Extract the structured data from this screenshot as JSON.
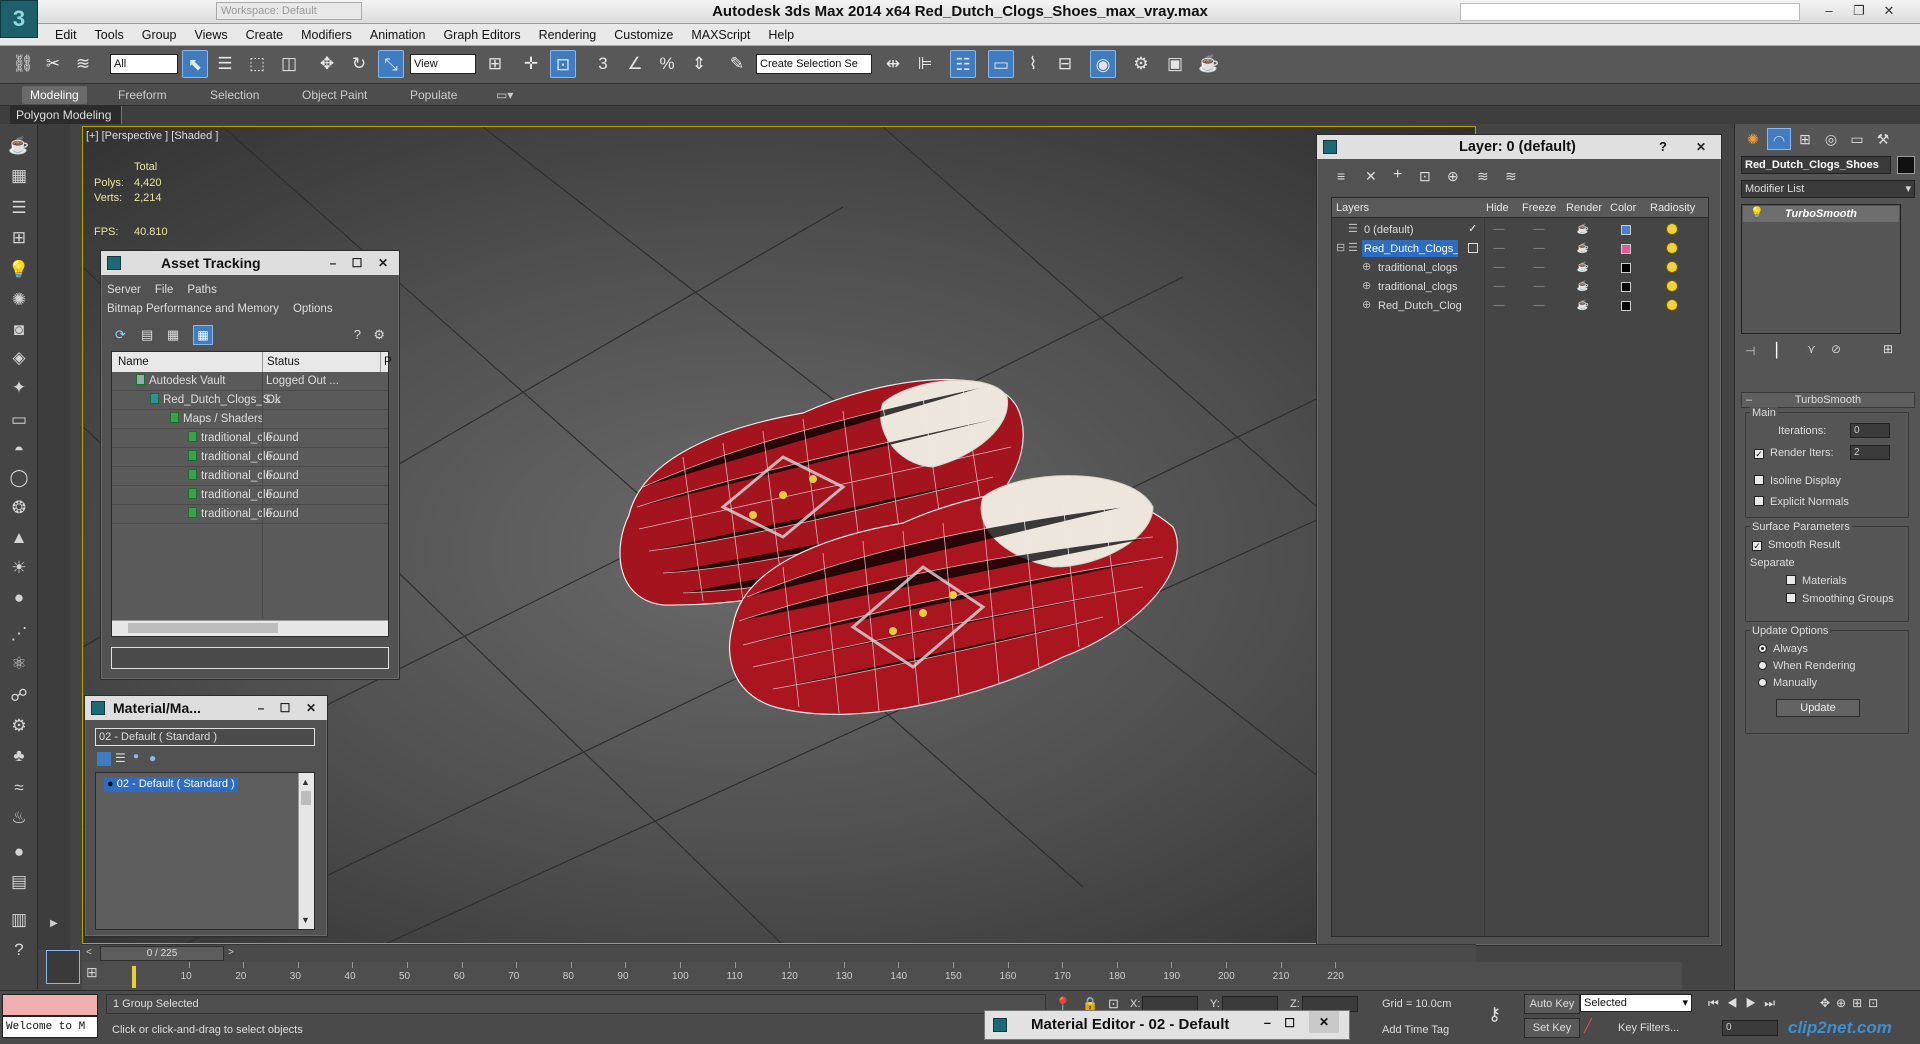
{
  "app": {
    "logo_letter": "3",
    "title": "Autodesk 3ds Max  2014 x64      Red_Dutch_Clogs_Shoes_max_vray.max",
    "workspace": "Workspace: Default",
    "window_buttons": {
      "minimize": "–",
      "restore": "❐",
      "close": "✕"
    }
  },
  "menu": [
    "Edit",
    "Tools",
    "Group",
    "Views",
    "Create",
    "Modifiers",
    "Animation",
    "Graph Editors",
    "Rendering",
    "Customize",
    "MAXScript",
    "Help"
  ],
  "toolbar": {
    "selection_filter": "All",
    "ref_coord": "View",
    "named_selection_placeholder": "Create Selection Se"
  },
  "ribbon": {
    "tabs": [
      "Modeling",
      "Freeform",
      "Selection",
      "Object Paint",
      "Populate"
    ],
    "active_tab": "Modeling",
    "subtab": "Polygon Modeling"
  },
  "viewport": {
    "label": "[+] [Perspective ] [Shaded ]",
    "stats": {
      "total_label": "Total",
      "polys_label": "Polys:",
      "polys_value": "4,420",
      "verts_label": "Verts:",
      "verts_value": "2,214",
      "fps_label": "FPS:",
      "fps_value": "40.810"
    }
  },
  "asset_tracking": {
    "title": "Asset Tracking",
    "menu": [
      "Server",
      "File",
      "Paths"
    ],
    "menu2": [
      "Bitmap Performance and Memory",
      "Options"
    ],
    "columns": [
      "Name",
      "Status",
      "P"
    ],
    "rows": [
      {
        "name": "Autodesk Vault",
        "status": "Logged Out ..."
      },
      {
        "name": "Red_Dutch_Clogs_S...",
        "status": "Ok"
      },
      {
        "name": "Maps / Shaders",
        "status": ""
      },
      {
        "name": "traditional_clo...",
        "status": "Found"
      },
      {
        "name": "traditional_clo...",
        "status": "Found"
      },
      {
        "name": "traditional_clo...",
        "status": "Found"
      },
      {
        "name": "traditional_clo...",
        "status": "Found"
      },
      {
        "name": "traditional_clo...",
        "status": "Found"
      }
    ]
  },
  "material_explorer": {
    "title": "Material/Ma...",
    "dropdown": "02 - Default  ( Standard )",
    "selected_item": "02 - Default  ( Standard )"
  },
  "layer_manager": {
    "title": "Layer: 0 (default)",
    "help": "?",
    "columns": [
      "Layers",
      "Hide",
      "Freeze",
      "Render",
      "Color",
      "Radiosity"
    ],
    "rows": [
      {
        "name": "0 (default)",
        "color": "#4a7fd0",
        "current": true
      },
      {
        "name": "Red_Dutch_Clogs_S",
        "color": "#e05a9a",
        "selected": true
      },
      {
        "name": "traditional_clogs",
        "color": "#000000"
      },
      {
        "name": "traditional_clogs",
        "color": "#000000"
      },
      {
        "name": "Red_Dutch_Clog",
        "color": "#000000"
      }
    ]
  },
  "command_panel": {
    "object_name": "Red_Dutch_Clogs_Shoes",
    "modifier_list": "Modifier List",
    "stack_item": "TurboSmooth",
    "rollout_title": "TurboSmooth",
    "main_label": "Main",
    "iterations_label": "Iterations:",
    "iterations_value": "0",
    "render_iters_label": "Render Iters:",
    "render_iters_value": "2",
    "isoline": "Isoline Display",
    "explicit_normals": "Explicit Normals",
    "surface_params": "Surface Parameters",
    "smooth_result": "Smooth Result",
    "separate": "Separate",
    "materials": "Materials",
    "smoothing_groups": "Smoothing Groups",
    "update_options": "Update Options",
    "always": "Always",
    "when_rendering": "When Rendering",
    "manually": "Manually",
    "update_button": "Update"
  },
  "timeline": {
    "frame_counter": "0 / 225",
    "ticks": [
      10,
      20,
      30,
      40,
      50,
      60,
      70,
      80,
      90,
      100,
      110,
      120,
      130,
      140,
      150,
      160,
      170,
      180,
      190,
      200,
      210,
      220
    ]
  },
  "status": {
    "maxscript_output": "Welcome to M",
    "selection": "1 Group Selected",
    "prompt": "Click or click-and-drag to select objects",
    "x_label": "X:",
    "y_label": "Y:",
    "z_label": "Z:",
    "grid": "Grid = 10.0cm",
    "add_time_tag": "Add Time Tag",
    "auto_key": "Auto Key",
    "auto_key_mode": "Selected",
    "set_key": "Set Key",
    "key_filters": "Key Filters...",
    "frame": "0",
    "material_editor_tab": "Material Editor - 02 - Default",
    "watermark": "clip2net.com"
  }
}
